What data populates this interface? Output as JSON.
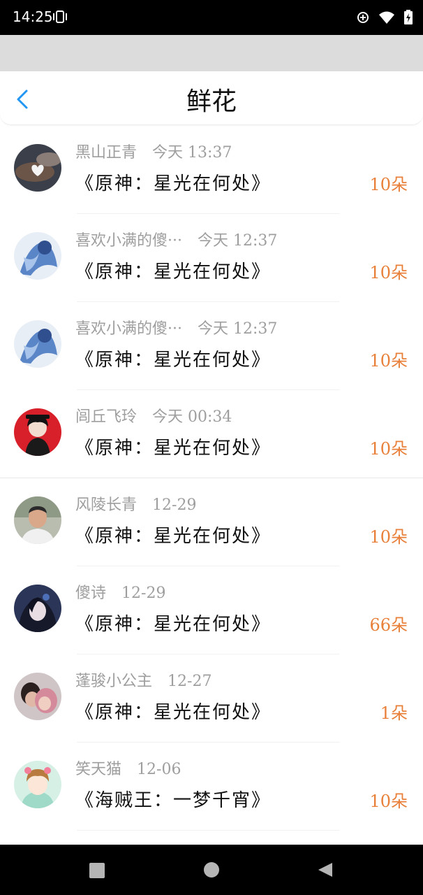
{
  "status_bar": {
    "time": "14:25",
    "icons": [
      "vibrate-icon",
      "data-saver-icon",
      "wifi-icon",
      "battery-charging-icon"
    ]
  },
  "header": {
    "title": "鲜花",
    "back_icon": "chevron-left-icon"
  },
  "colors": {
    "accent_blue": "#2196f3",
    "count_orange": "#e8803a",
    "meta_gray": "#9e9e9e"
  },
  "rows": [
    {
      "name": "黑山正青",
      "time": "今天 13:37",
      "work": "《原神：星光在何处》",
      "count": "10朵",
      "avatar": "dark-night-heart-avatar"
    },
    {
      "name": "喜欢小满的傻···",
      "time": "今天 12:37",
      "work": "《原神：星光在何处》",
      "count": "10朵",
      "avatar": "blue-anime-avatar"
    },
    {
      "name": "喜欢小满的傻···",
      "time": "今天 12:37",
      "work": "《原神：星光在何处》",
      "count": "10朵",
      "avatar": "blue-anime-avatar"
    },
    {
      "name": "闾丘飞玲",
      "time": "今天 00:34",
      "work": "《原神：星光在何处》",
      "count": "10朵",
      "avatar": "red-anime-avatar"
    },
    {
      "name": "风陵长青",
      "time": "12-29",
      "work": "《原神：星光在何处》",
      "count": "10朵",
      "avatar": "man-photo-avatar"
    },
    {
      "name": "傻诗",
      "time": "12-29",
      "work": "《原神：星光在何处》",
      "count": "66朵",
      "avatar": "dark-anime-girl-avatar"
    },
    {
      "name": "蓬骏小公主",
      "time": "12-27",
      "work": "《原神：星光在何处》",
      "count": "1朵",
      "avatar": "couple-photo-avatar"
    },
    {
      "name": "笑天猫",
      "time": "12-06",
      "work": "《海贼王：一梦千宵》",
      "count": "10朵",
      "avatar": "cardcaptor-girl-avatar"
    }
  ],
  "bottom_nav": {
    "icons": [
      "recents-square-icon",
      "home-circle-icon",
      "back-triangle-icon"
    ]
  }
}
